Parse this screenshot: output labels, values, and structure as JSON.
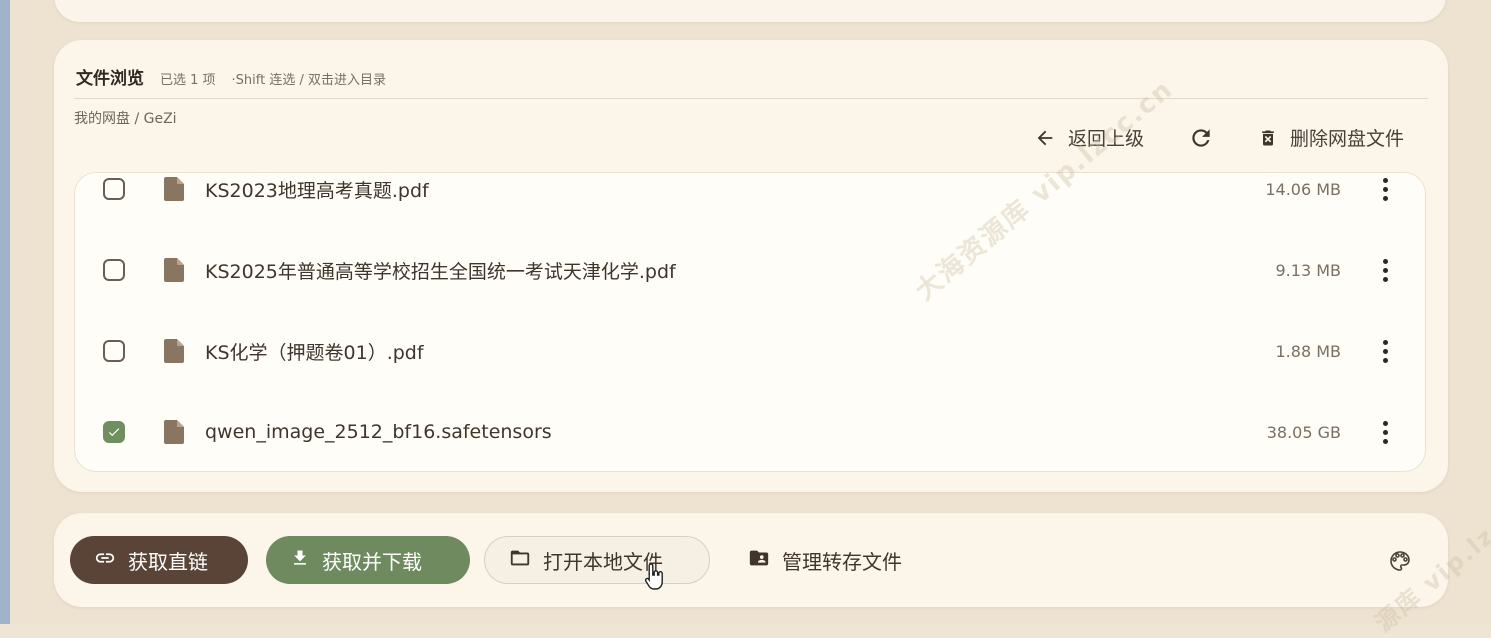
{
  "browser": {
    "title": "文件浏览",
    "selected_count": "已选 1 项",
    "hint": "·Shift 连选 / 双击进入目录",
    "breadcrumb": "我的网盘 / GeZi",
    "toolbar": {
      "back_label": "返回上级",
      "refresh_icon": "refresh-icon",
      "delete_label": "删除网盘文件"
    },
    "files": [
      {
        "name": "KS2023地理高考真题.pdf",
        "size": "14.06 MB",
        "checked": false
      },
      {
        "name": "KS2025年普通高等学校招生全国统一考试天津化学.pdf",
        "size": "9.13 MB",
        "checked": false
      },
      {
        "name": "KS化学（押题卷01）.pdf",
        "size": "1.88 MB",
        "checked": false
      },
      {
        "name": "qwen_image_2512_bf16.safetensors",
        "size": "38.05 GB",
        "checked": true
      }
    ]
  },
  "actions": {
    "get_link": "获取直链",
    "get_download": "获取并下载",
    "open_local": "打开本地文件",
    "manage_saved": "管理转存文件"
  },
  "watermark": {
    "text_1": "大海资源库 vip.lzcc.cn",
    "text_2": "源库 vip.lz"
  },
  "colors": {
    "background": "#eee3d1",
    "card": "#fbf5ea",
    "brown_button": "#5a4438",
    "green_button": "#6f8a5f",
    "checkbox_checked": "#6f8f60"
  }
}
